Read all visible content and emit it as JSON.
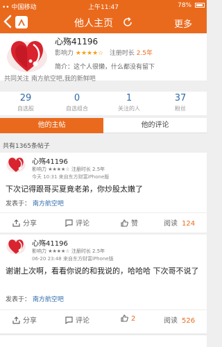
{
  "status_bar": {
    "carrier": "•• 中国移动",
    "time": "上午11:47",
    "battery": "78%"
  },
  "header": {
    "back_icon": "chevron-left-icon",
    "logo_icon": "app-logo-icon",
    "title": "他人主页",
    "refresh_icon": "refresh-icon",
    "more_label": "更多"
  },
  "profile": {
    "name": "心殇41196",
    "influence_label": "影响力",
    "stars": "★★★★☆",
    "registration_label": "注册时长",
    "registration_value": "2.5年",
    "bio": "简介：这个人很懒，什么都没有留下",
    "follow": "共同关注 南方航空吧,我的新鲜吧"
  },
  "stats": [
    {
      "value": "29",
      "label": "自选股"
    },
    {
      "value": "0",
      "label": "自选组合"
    },
    {
      "value": "1",
      "label": "关注的人"
    },
    {
      "value": "37",
      "label": "粉丝"
    }
  ],
  "tabs": {
    "active": "他的主帖",
    "inactive": "他的评论"
  },
  "post_count": "共有1365条帖子",
  "posts": [
    {
      "name": "心殇41196",
      "meta": "影响力 ★★★★☆ 注册时长 2.5年",
      "time": "今天 10:31  来自东方财富iPhone版",
      "content": "下次记得跟哥买夏竟老弟，你炒股太嫩了",
      "source_label": "发表于：",
      "source_link": "南方航空吧",
      "share": "分享",
      "comment": "评论",
      "like": "赞",
      "read": "阅读",
      "read_count": "124"
    },
    {
      "name": "心殇41196",
      "meta": "影响力 ★★★★☆ 注册时长 2.5年",
      "time": "06-20 23:48  来自东方财富iPhone版",
      "content": "谢谢上次啊，看看你说的和我说的，哈哈哈 下次哥不说了",
      "source_label": "发表于：",
      "source_link": "南方航空吧",
      "share": "分享",
      "comment": "评论",
      "like": "2",
      "read": "阅读",
      "read_count": "526"
    }
  ],
  "colors": {
    "brand_orange": "#ea6a1d",
    "link_blue": "#2e6aa7",
    "star": "#f2a01a"
  }
}
